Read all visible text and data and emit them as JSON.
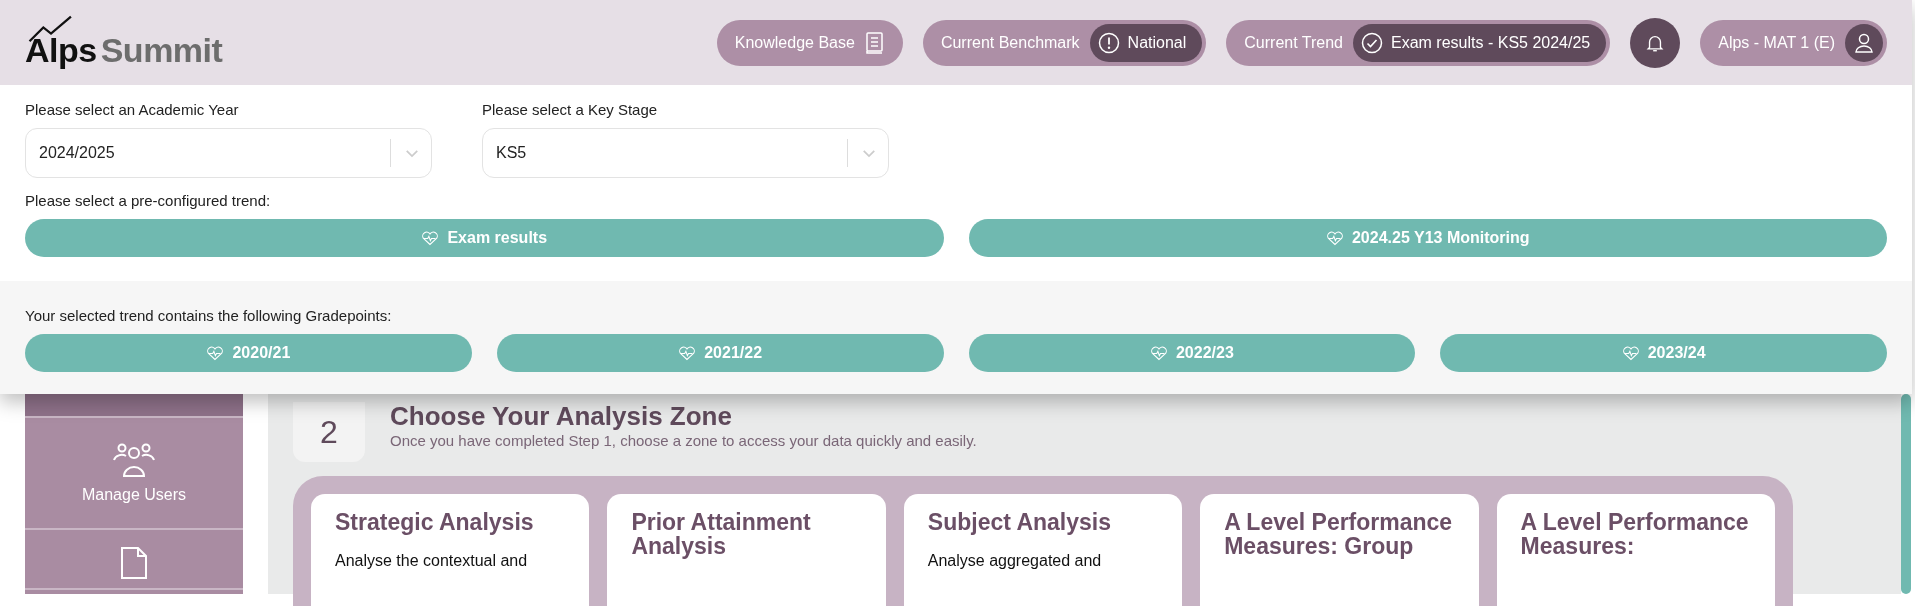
{
  "header": {
    "logo": {
      "part_1": "Alps",
      "part_2": "Summit"
    },
    "knowledge_base": "Knowledge Base",
    "benchmark": {
      "label": "Current Benchmark",
      "value": "National"
    },
    "trend": {
      "label": "Current Trend",
      "value": "Exam results - KS5 2024/25"
    },
    "user": "Alps - MAT 1 (E)"
  },
  "filters": [
    {
      "label": "Please select an Academic Year",
      "value": "2024/2025"
    },
    {
      "label": "Please select a Key Stage",
      "value": "KS5"
    }
  ],
  "trend_prompt": "Please select a pre-configured trend:",
  "trends": [
    "Exam results",
    "2024.25 Y13 Monitoring"
  ],
  "gradepoints_prompt": "Your selected trend contains the following Gradepoints:",
  "gradepoints": [
    "2020/21",
    "2021/22",
    "2022/23",
    "2023/24"
  ],
  "sidebar": {
    "items": [
      {
        "kind": "blank",
        "selected": true
      },
      {
        "kind": "users",
        "label": "Manage Users",
        "selected": false
      },
      {
        "kind": "document",
        "selected": false
      }
    ]
  },
  "step": {
    "number": "2",
    "title": "Choose Your Analysis Zone",
    "subtitle": "Once you have completed Step 1, choose a zone to access your data quickly and easily."
  },
  "zones": [
    {
      "title": "Strategic Analysis",
      "text": "Analyse the contextual and"
    },
    {
      "title": "Prior Attainment Analysis"
    },
    {
      "title": "Subject Analysis",
      "text": "Analyse aggregated and"
    },
    {
      "title": "A Level Performance Measures: Group"
    },
    {
      "title": "A Level Performance Measures:"
    }
  ]
}
